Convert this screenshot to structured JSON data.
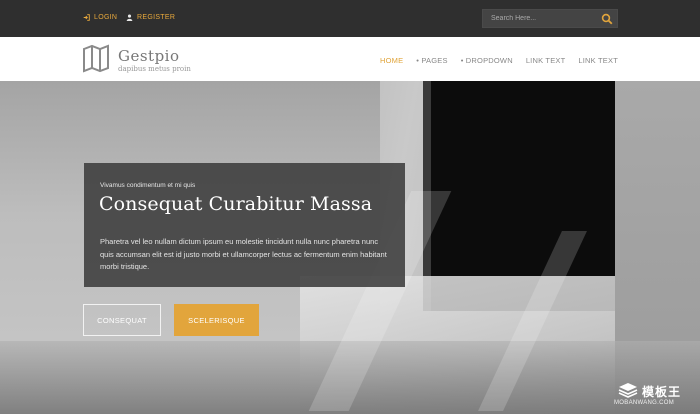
{
  "topbar": {
    "login_label": "LOGIN",
    "register_label": "REGISTER",
    "search_placeholder": "Search Here..."
  },
  "brand": {
    "name": "Gestpio",
    "tagline": "dapibus metus proin"
  },
  "nav": {
    "items": [
      {
        "label": "HOME",
        "active": true
      },
      {
        "label": "• PAGES",
        "active": false
      },
      {
        "label": "• DROPDOWN",
        "active": false
      },
      {
        "label": "LINK TEXT",
        "active": false
      },
      {
        "label": "LINK TEXT",
        "active": false
      }
    ]
  },
  "hero": {
    "kicker": "Vivamus condimentum et mi quis",
    "headline": "Consequat Curabitur Massa",
    "body": "Pharetra vel leo nullam dictum ipsum eu molestie tincidunt nulla nunc pharetra nunc quis accumsan elit est id justo morbi et ullamcorper lectus ac fermentum enim habitant morbi tristique.",
    "button_primary": "CONSEQUAT",
    "button_secondary": "SCELERISQUE"
  },
  "watermark": {
    "cn_text": "模板王",
    "en_text": "MOBANWANG.COM"
  },
  "colors": {
    "accent": "#e2a53c",
    "topbar_bg": "#2f2f2f",
    "header_bg": "#ffffff",
    "panel_bg": "#3c3c3c"
  },
  "icons": {
    "login": "login-icon",
    "register": "user-icon",
    "search": "search-icon",
    "logo": "book-logo-icon"
  }
}
